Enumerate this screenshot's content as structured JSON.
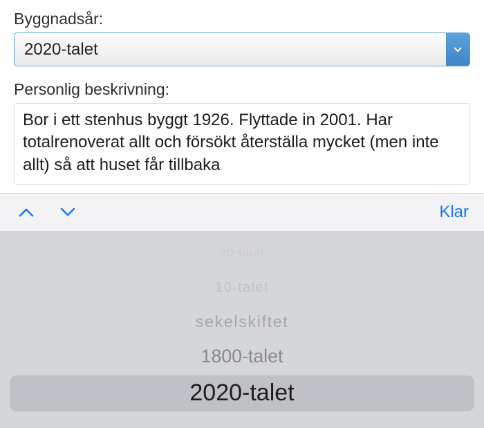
{
  "form": {
    "year_label": "Byggnadsår:",
    "year_value": "2020-talet",
    "desc_label": "Personlig beskrivning:",
    "desc_value": "Bor i ett stenhus byggt 1926. Flyttade in 2001. Har totalrenoverat allt och försökt återställa mycket (men inte allt) så att huset får tillbaka"
  },
  "accessory": {
    "done": "Klar"
  },
  "picker": {
    "options": [
      "20-talet",
      "10-talet",
      "sekelskiftet",
      "1800-talet",
      "2020-talet"
    ],
    "selected_index": 4
  }
}
